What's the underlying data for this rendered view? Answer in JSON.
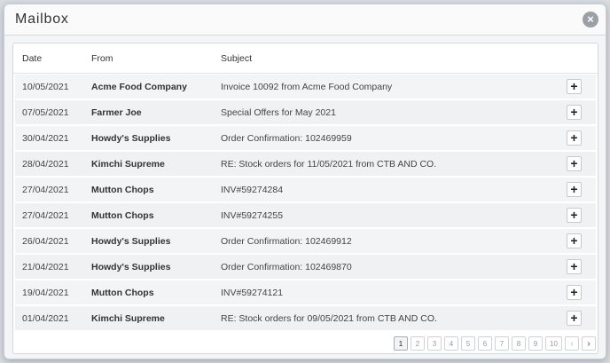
{
  "modal": {
    "title": "Mailbox",
    "close_label": "×"
  },
  "table": {
    "headers": {
      "date": "Date",
      "from": "From",
      "subject": "Subject"
    },
    "rows": [
      {
        "date": "10/05/2021",
        "from": "Acme Food Company",
        "subject": "Invoice 10092 from Acme Food Company"
      },
      {
        "date": "07/05/2021",
        "from": "Farmer Joe",
        "subject": "Special Offers for May 2021"
      },
      {
        "date": "30/04/2021",
        "from": "Howdy's Supplies",
        "subject": "Order Confirmation: 102469959"
      },
      {
        "date": "28/04/2021",
        "from": "Kimchi Supreme",
        "subject": "RE: Stock orders for 11/05/2021 from CTB AND CO."
      },
      {
        "date": "27/04/2021",
        "from": "Mutton Chops",
        "subject": "INV#59274284"
      },
      {
        "date": "27/04/2021",
        "from": "Mutton Chops",
        "subject": "INV#59274255"
      },
      {
        "date": "26/04/2021",
        "from": "Howdy's Supplies",
        "subject": "Order Confirmation: 102469912"
      },
      {
        "date": "21/04/2021",
        "from": "Howdy's Supplies",
        "subject": "Order Confirmation: 102469870"
      },
      {
        "date": "19/04/2021",
        "from": "Mutton Chops",
        "subject": "INV#59274121"
      },
      {
        "date": "01/04/2021",
        "from": "Kimchi Supreme",
        "subject": "RE: Stock orders for 09/05/2021 from CTB AND CO."
      }
    ],
    "row_action_label": "+"
  },
  "pagination": {
    "pages": [
      "1",
      "2",
      "3",
      "4",
      "5",
      "6",
      "7",
      "8",
      "9",
      "10"
    ],
    "current": "1",
    "prev_label": "‹",
    "next_label": "›"
  }
}
